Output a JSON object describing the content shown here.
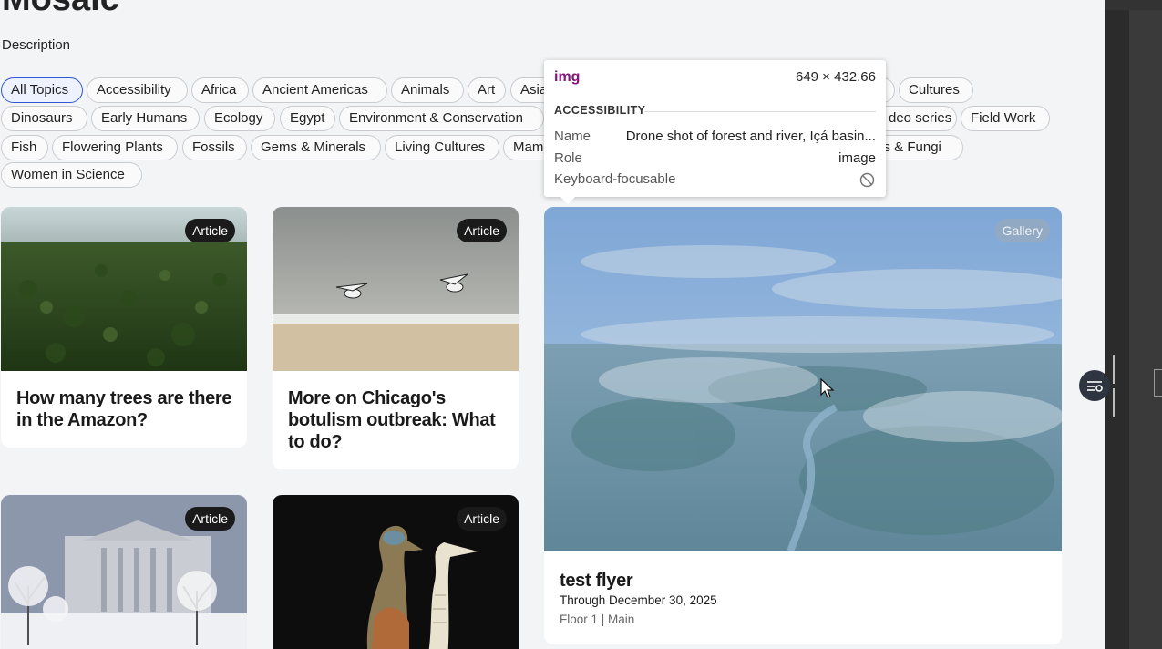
{
  "page": {
    "title": "Mosaic",
    "description": "Description"
  },
  "topics": [
    "All Topics",
    "Accessibility",
    "Africa",
    "Ancient Americas",
    "Animals",
    "Art",
    "Asia",
    "Cultures",
    "Dinosaurs",
    "Early Humans",
    "Ecology",
    "Egypt",
    "Environment & Conservation",
    "deo series",
    "Field Work",
    "Fish",
    "Flowering Plants",
    "Fossils",
    "Gems & Minerals",
    "Living Cultures",
    "Mam",
    "nts & Fungi",
    "Women in Science"
  ],
  "cards": [
    {
      "badge": "Article",
      "title": "How many trees are there in the Amazon?"
    },
    {
      "badge": "Article",
      "title": "More on Chicago's botulism outbreak: What to do?"
    },
    {
      "badge": "Gallery",
      "title": "test flyer",
      "date": "Through December 30, 2025",
      "location": "Floor 1 | Main"
    },
    {
      "badge": "Article"
    },
    {
      "badge": "Article"
    }
  ],
  "tooltip": {
    "tag": "img",
    "size": "649 × 432.66",
    "section": "ACCESSIBILITY",
    "name_label": "Name",
    "name_value": "Drone shot of forest and river, Içá basin...",
    "role_label": "Role",
    "role_value": "image",
    "focus_label": "Keyboard-focusable"
  },
  "icons": [
    "blocked-icon",
    "mouse-cursor-icon",
    "filter-toggle-icon",
    "drag-handle-icon"
  ],
  "colors": {
    "accent": "#3056d3",
    "tooltip_tag": "#881280",
    "page_bg": "#f3f4f6"
  }
}
